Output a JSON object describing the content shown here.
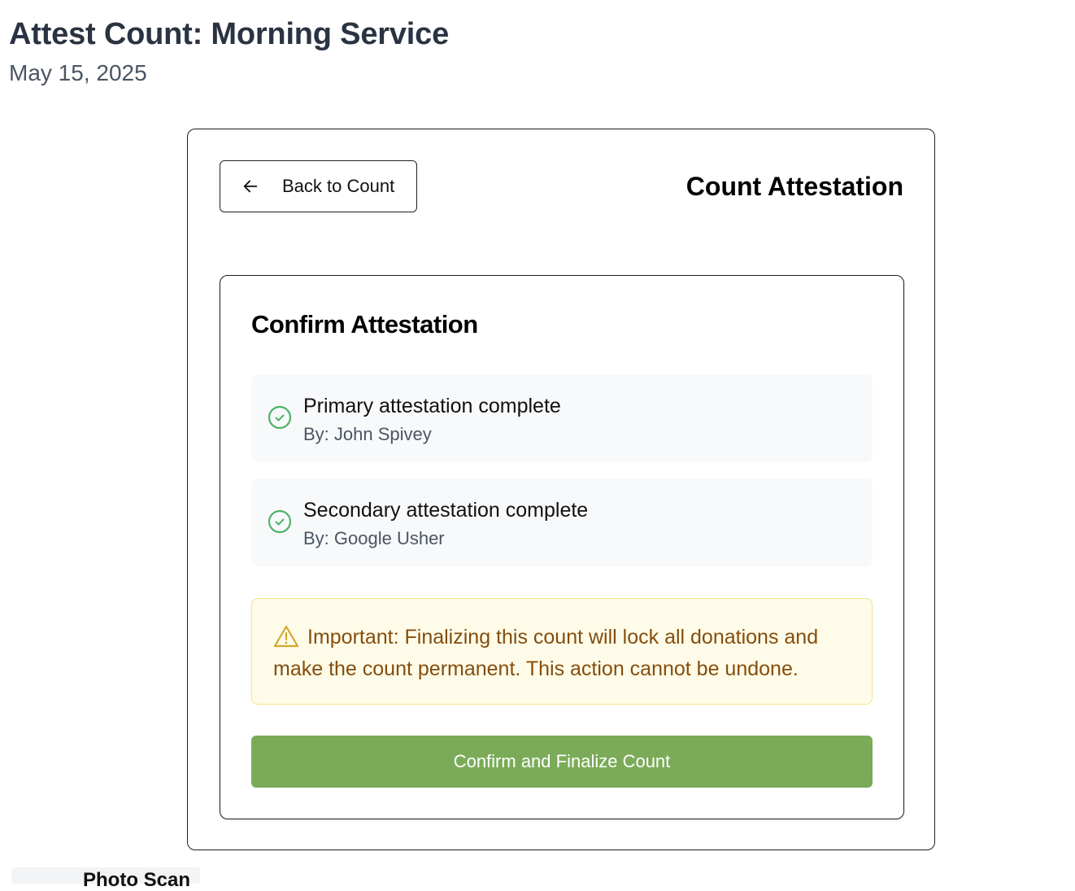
{
  "page": {
    "title": "Attest Count: Morning Service",
    "date": "May 15, 2025"
  },
  "card": {
    "back_label": "Back to Count",
    "heading": "Count Attestation"
  },
  "confirm": {
    "heading": "Confirm Attestation",
    "items": [
      {
        "title": "Primary attestation complete",
        "by": "By: John Spivey",
        "icon": "check-circle-icon",
        "status_color": "#4fb36a"
      },
      {
        "title": "Secondary attestation complete",
        "by": "By: Google Usher",
        "icon": "check-circle-icon",
        "status_color": "#4fb36a"
      }
    ],
    "warning": {
      "icon": "warning-triangle-icon",
      "text": "Important: Finalizing this count will lock all donations and make the count permanent. This action cannot be undone."
    },
    "button_label": "Confirm and Finalize Count"
  },
  "colors": {
    "primary_button": "#7bab58",
    "warning_bg": "#fefce8",
    "warning_text": "#854d0e",
    "success": "#4fb36a"
  },
  "below": {
    "partial_text": "Photo Scan"
  }
}
